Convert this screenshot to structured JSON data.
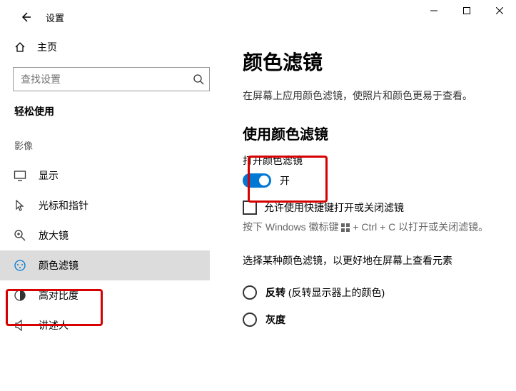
{
  "app": {
    "name": "设置"
  },
  "sidebar": {
    "home": "主页",
    "search_placeholder": "查找设置",
    "group": "轻松使用",
    "subgroup": "影像",
    "items": [
      {
        "label": "显示"
      },
      {
        "label": "光标和指针"
      },
      {
        "label": "放大镜"
      },
      {
        "label": "颜色滤镜"
      },
      {
        "label": "高对比度"
      },
      {
        "label": "讲述人"
      }
    ]
  },
  "main": {
    "title": "颜色滤镜",
    "lead": "在屏幕上应用颜色滤镜，使照片和颜色更易于查看。",
    "use_heading": "使用颜色滤镜",
    "toggle_label": "打开颜色滤镜",
    "toggle_state": "开",
    "shortcut_checkbox": "允许使用快捷键打开或关闭滤镜",
    "shortcut_hint_a": "按下 Windows 徽标键 ",
    "shortcut_hint_b": " + Ctrl + C 以打开或关闭滤镜。",
    "choose_label": "选择某种颜色滤镜，以更好地在屏幕上查看元素",
    "radios": [
      {
        "bold": "反转",
        "rest": " (反转显示器上的颜色)"
      },
      {
        "bold": "灰度",
        "rest": ""
      }
    ]
  }
}
